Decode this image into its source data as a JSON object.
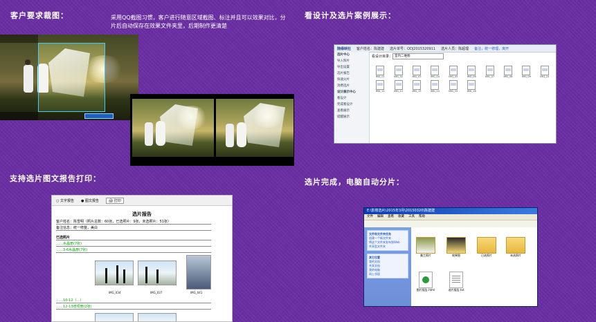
{
  "sections": {
    "client_request": {
      "title": "客户要求裁图：",
      "desc": "采用QQ截图习惯，客户进行随意区域截图、标注并且可以效果对比，分片后自动保存在效果文件夹里，后期制作更清楚"
    },
    "design_showcase": {
      "title": "看设计及选片案例展示："
    },
    "report_print": {
      "title": "支持选片图文报告打印："
    },
    "auto_split": {
      "title": "选片完成，电脑自动分片："
    }
  },
  "viewer": {
    "logo": "随缘映社",
    "customer": "客户姓名：陈建建",
    "order": "选片单号：ODJ2015320911",
    "staff": "选片人员：陈超理",
    "links": "备注，统一修理，离开",
    "sidebar": [
      "选片中心",
      "导入照片",
      "导出设置",
      "选片报告",
      "快速分片",
      "消费选片",
      "设计展示中心",
      "看设计",
      "完成看设计",
      "查看展示",
      "提醒展示"
    ],
    "folder_label": "看设计目录：",
    "folder_value": "室内二维图",
    "files": [
      "IMG_01",
      "IMG_02",
      "IMG_03",
      "IMG_04",
      "IMG_05",
      "IMG_06",
      "IMG_07",
      "IMG_08",
      "IMG_09",
      "IMG_10",
      "IMG_11",
      "IMG_12",
      "IMG_13",
      "IMG_14",
      "IMG_15",
      "IMG_16"
    ]
  },
  "report": {
    "toolbar": [
      "文字报告",
      "图文报告",
      "打印"
    ],
    "title": "选片报告",
    "line1": "客户姓名：陈雪明（照片总数：60张，已选照片：9张，未选照片：51张）",
    "line2": "备注信息：统一修整，美白",
    "line3": "已选照片",
    "line4": "……水晶册(7张)",
    "line5": "……3-6水晶册(7张)",
    "captions": [
      "IMG_034",
      "IMG_037",
      "IMG_041"
    ],
    "line6": "……10-12（…）",
    "line7": "……12-13增项册(2张)"
  },
  "explorer": {
    "title": "E:\\影楼选片\\2015年3月\\20150320\\陈建建",
    "menu": [
      "文件",
      "编辑",
      "查看",
      "收藏",
      "工具",
      "帮助"
    ],
    "tasks_title": "文件和文件夹任务",
    "tasks": [
      "创建一个新文件夹",
      "将这个文件夹发布到Web",
      "共享此文件夹"
    ],
    "other_title": "其它位置",
    "other": [
      "我的文档",
      "共享文档",
      "我的电脑",
      "网上邻居"
    ],
    "items": [
      "美工照片",
      "效果图",
      "已选照片",
      "未选照片",
      "图片报告.html",
      "选片报告.txt"
    ]
  }
}
